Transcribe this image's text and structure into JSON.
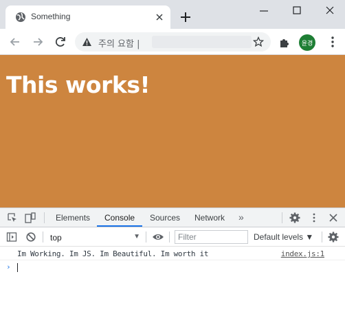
{
  "browser": {
    "tab_title": "Something",
    "security_warning": "주의 요함 |",
    "profile_initials": "윤경"
  },
  "page": {
    "heading": "This works!",
    "background_color": "#cd853f"
  },
  "devtools": {
    "tabs": [
      "Elements",
      "Console",
      "Sources",
      "Network"
    ],
    "active_tab": "Console",
    "more_tabs": "»",
    "context": "top",
    "filter_placeholder": "Filter",
    "log_levels": "Default levels ▼",
    "console_messages": [
      {
        "text": "Im Working. Im JS. Im Beautiful. Im worth it",
        "source": "index.js:1"
      }
    ],
    "prompt_symbol": "›"
  }
}
